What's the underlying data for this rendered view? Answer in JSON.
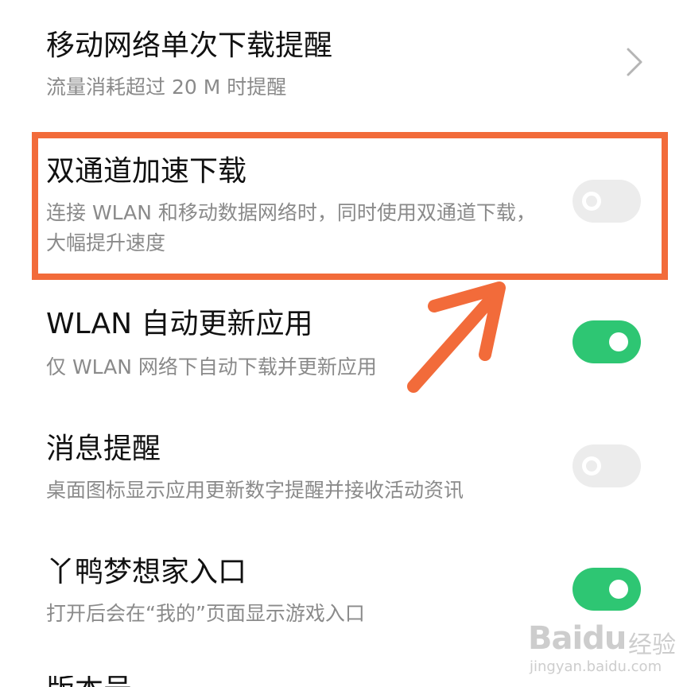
{
  "settings": [
    {
      "title": "移动网络单次下载提醒",
      "subtitle": "流量消耗超过 20 M 时提醒",
      "control": "chevron"
    },
    {
      "title": "双通道加速下载",
      "subtitle": "连接 WLAN 和移动数据网络时，同时使用双通道下载，大幅提升速度",
      "control": "toggle",
      "state": "off"
    },
    {
      "title": "WLAN 自动更新应用",
      "subtitle": "仅 WLAN 网络下自动下载并更新应用",
      "control": "toggle",
      "state": "on"
    },
    {
      "title": "消息提醒",
      "subtitle": "桌面图标显示应用更新数字提醒并接收活动资讯",
      "control": "toggle",
      "state": "off"
    },
    {
      "title": "丫鸭梦想家入口",
      "subtitle": "打开后会在“我的”页面显示游戏入口",
      "control": "toggle",
      "state": "on"
    },
    {
      "title": "版本号"
    }
  ],
  "annotation": {
    "color": "#f26b3a",
    "highlight_target": "双通道加速下载"
  },
  "colors": {
    "toggle_on": "#2ec673",
    "toggle_off": "#ececec"
  },
  "watermark": {
    "logo": "Baidu",
    "cn": "经验",
    "url": "jingyan.baidu.com"
  }
}
